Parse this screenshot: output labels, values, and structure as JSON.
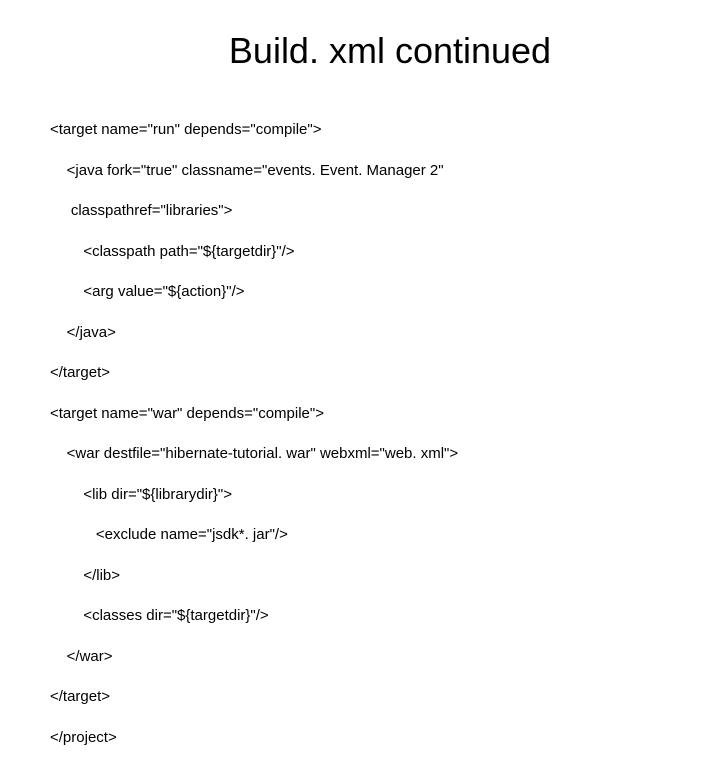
{
  "title": "Build. xml continued",
  "code": {
    "l1": "<target name=\"run\" depends=\"compile\">",
    "l2": "    <java fork=\"true\" classname=\"events. Event. Manager 2\"",
    "l3": "     classpathref=\"libraries\">",
    "l4": "        <classpath path=\"${targetdir}\"/>",
    "l5": "        <arg value=\"${action}\"/>",
    "l6": "    </java>",
    "l7": "</target>",
    "l8": "<target name=\"war\" depends=\"compile\">",
    "l9": "    <war destfile=\"hibernate-tutorial. war\" webxml=\"web. xml\">",
    "l10": "        <lib dir=\"${librarydir}\">",
    "l11": "           <exclude name=\"jsdk*. jar\"/>",
    "l12": "        </lib>",
    "l13": "        <classes dir=\"${targetdir}\"/>",
    "l14": "    </war>",
    "l15": "</target>",
    "l16": "</project>"
  }
}
